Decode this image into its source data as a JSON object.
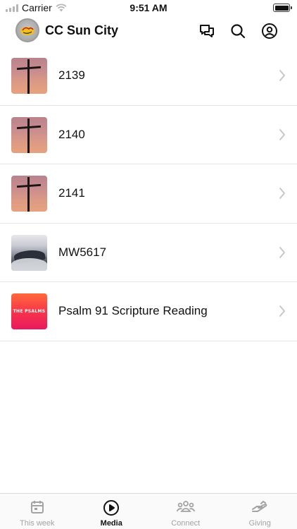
{
  "status_bar": {
    "carrier": "Carrier",
    "time": "9:51 AM"
  },
  "header": {
    "title": "CC Sun City"
  },
  "icons": {
    "chat": "chat-bubbles-icon",
    "search": "search-icon",
    "profile": "profile-icon",
    "chevron": "chevron-right-icon"
  },
  "media_items": [
    {
      "title": "2139",
      "thumbnail": "cross-sunset"
    },
    {
      "title": "2140",
      "thumbnail": "cross-sunset"
    },
    {
      "title": "2141",
      "thumbnail": "cross-sunset"
    },
    {
      "title": "MW5617",
      "thumbnail": "mountain-clouds"
    },
    {
      "title": "Psalm 91 Scripture Reading",
      "thumbnail": "the-psalms",
      "thumbnail_text": "THE PSALMS"
    }
  ],
  "tabs": [
    {
      "label": "This week",
      "icon": "calendar-icon",
      "active": false
    },
    {
      "label": "Media",
      "icon": "play-circle-icon",
      "active": true
    },
    {
      "label": "Connect",
      "icon": "people-icon",
      "active": false
    },
    {
      "label": "Giving",
      "icon": "giving-hand-icon",
      "active": false
    }
  ],
  "colors": {
    "active_tab": "#111111",
    "inactive_tab": "#a3a3a3",
    "divider": "#e4e4e4"
  }
}
